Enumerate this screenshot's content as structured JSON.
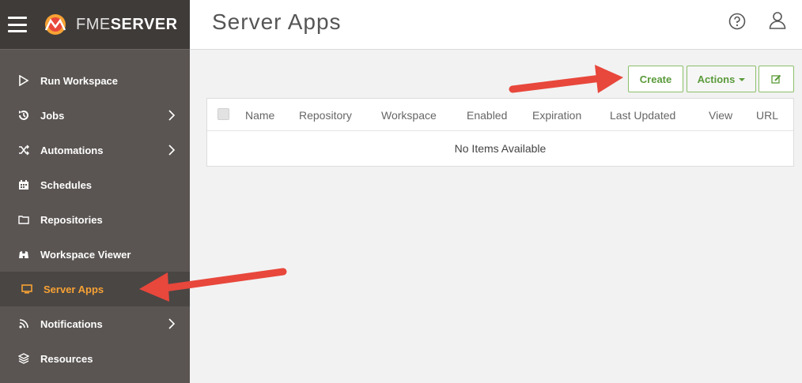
{
  "app": {
    "brand_prefix": "FME",
    "brand_suffix": "SERVER"
  },
  "header": {
    "title": "Server Apps",
    "help_icon": "help-circle-icon",
    "user_icon": "user-icon"
  },
  "sidebar": {
    "items": [
      {
        "label": "Run Workspace",
        "icon": "play-icon",
        "has_chevron": false,
        "active": false
      },
      {
        "label": "Jobs",
        "icon": "jobs-icon",
        "has_chevron": true,
        "active": false
      },
      {
        "label": "Automations",
        "icon": "shuffle-icon",
        "has_chevron": true,
        "active": false
      },
      {
        "label": "Schedules",
        "icon": "calendar-icon",
        "has_chevron": false,
        "active": false
      },
      {
        "label": "Repositories",
        "icon": "folder-icon",
        "has_chevron": false,
        "active": false
      },
      {
        "label": "Workspace Viewer",
        "icon": "binoculars-icon",
        "has_chevron": false,
        "active": false
      },
      {
        "label": "Server Apps",
        "icon": "monitor-icon",
        "has_chevron": false,
        "active": true
      },
      {
        "label": "Notifications",
        "icon": "rss-icon",
        "has_chevron": true,
        "active": false
      },
      {
        "label": "Resources",
        "icon": "layers-icon",
        "has_chevron": false,
        "active": false
      }
    ]
  },
  "toolbar": {
    "create_label": "Create",
    "actions_label": "Actions",
    "edit_icon": "edit-icon"
  },
  "table": {
    "columns": [
      "Name",
      "Repository",
      "Workspace",
      "Enabled",
      "Expiration",
      "Last Updated",
      "View",
      "URL"
    ],
    "empty_message": "No Items Available"
  },
  "colors": {
    "sidebar_bg": "#5a5552",
    "active_text": "#f7a234",
    "accent_green": "#5a9a3a",
    "annotation_arrow": "#e8473c"
  }
}
